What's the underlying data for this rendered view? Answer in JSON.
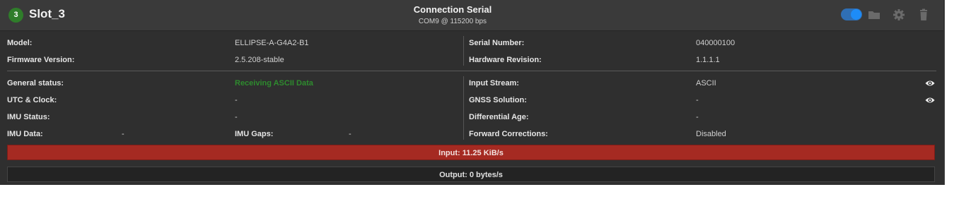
{
  "header": {
    "slot_number": "3",
    "slot_name": "Slot_3",
    "connection_title": "Connection Serial",
    "connection_subtitle": "COM9 @ 115200 bps",
    "toggle_enabled": true,
    "icons": [
      "toggle-switch",
      "folder-icon",
      "gear-icon",
      "trash-icon"
    ]
  },
  "device_info": {
    "model_label": "Model:",
    "model_value": "ELLIPSE-A-G4A2-B1",
    "firmware_label": "Firmware Version:",
    "firmware_value": "2.5.208-stable",
    "serial_label": "Serial Number:",
    "serial_value": "040000100",
    "hardware_label": "Hardware Revision:",
    "hardware_value": "1.1.1.1"
  },
  "status": {
    "general_label": "General status:",
    "general_value": "Receiving ASCII Data",
    "utc_label": "UTC & Clock:",
    "utc_value": "-",
    "imu_status_label": "IMU Status:",
    "imu_status_value": "-",
    "imu_data_label": "IMU Data:",
    "imu_data_value": "-",
    "imu_gaps_label": "IMU Gaps:",
    "imu_gaps_value": "-",
    "input_stream_label": "Input Stream:",
    "input_stream_value": "ASCII",
    "gnss_label": "GNSS Solution:",
    "gnss_value": "-",
    "diff_age_label": "Differential Age:",
    "diff_age_value": "-",
    "forward_label": "Forward Corrections:",
    "forward_value": "Disabled"
  },
  "throughput": {
    "input_text": "Input: 11.25 KiB/s",
    "output_text": "Output: 0 bytes/s"
  },
  "colors": {
    "status_ok": "#2e8b2e",
    "input_bar": "#a52a22",
    "toggle_on": "#1d8cf8",
    "badge": "#2f7d2a"
  }
}
